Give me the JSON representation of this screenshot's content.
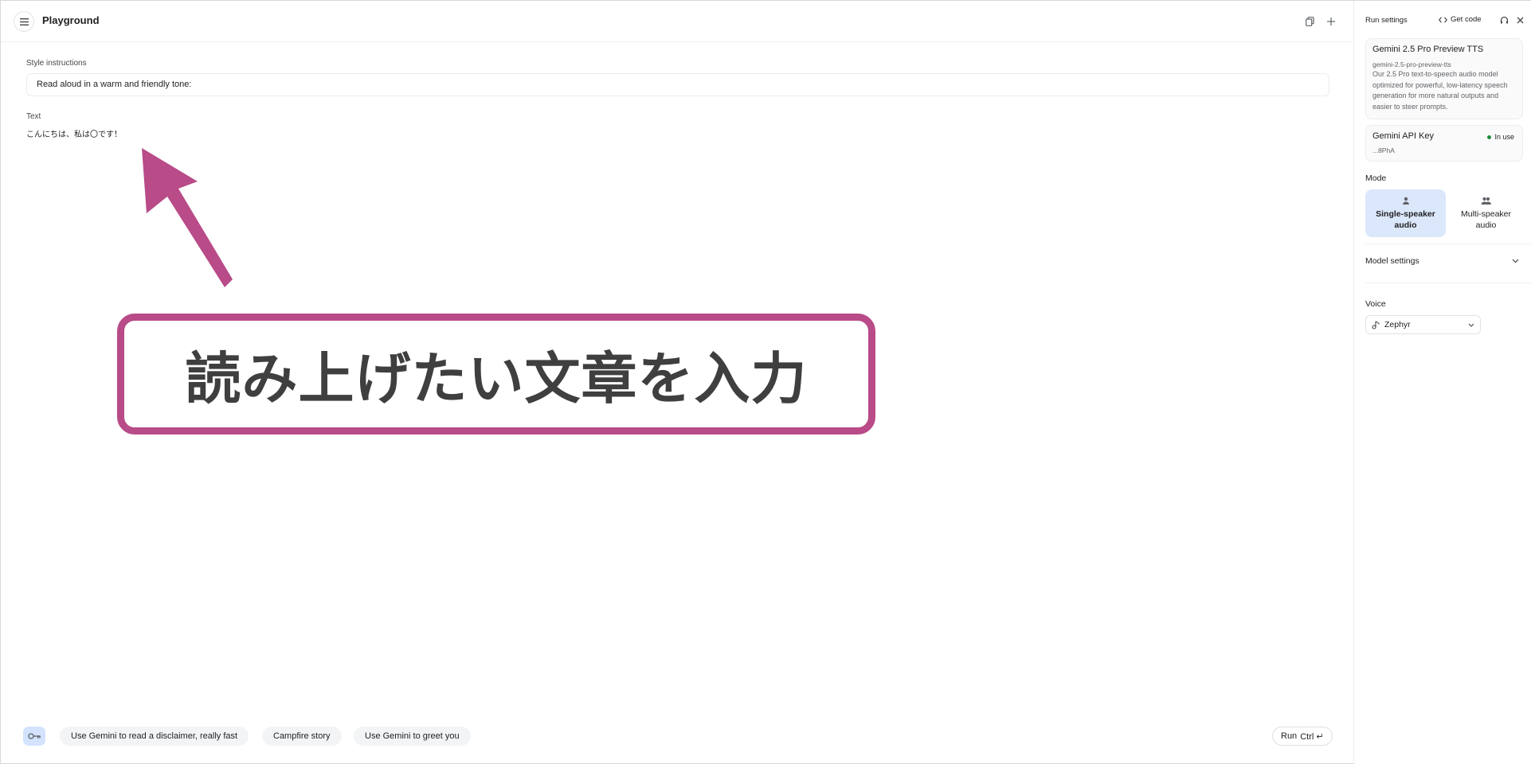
{
  "header": {
    "title": "Playground"
  },
  "style": {
    "label": "Style instructions",
    "value": "Read aloud in a warm and friendly tone:"
  },
  "text_field": {
    "label": "Text",
    "value": "こんにちは、私は〇です！"
  },
  "annotation": {
    "callout": "読み上げたい文章を入力",
    "color": "#b84b88"
  },
  "suggestions": [
    "Use Gemini to read a disclaimer, really fast",
    "Campfire story",
    "Use Gemini to greet you"
  ],
  "run": {
    "label": "Run",
    "shortcut": "Ctrl ↵"
  },
  "panel": {
    "title": "Run settings",
    "get_code": "Get code",
    "model": {
      "name": "Gemini 2.5 Pro Preview TTS",
      "id": "gemini-2.5-pro-preview-tts",
      "description": "Our 2.5 Pro text-to-speech audio model optimized for powerful, low-latency speech generation for more natural outputs and easier to steer prompts."
    },
    "api_key": {
      "title": "Gemini API Key",
      "status": "In use",
      "masked": "...8PhA"
    },
    "mode": {
      "label": "Mode",
      "single": "Single-speaker audio",
      "multi": "Multi-speaker audio"
    },
    "model_settings": "Model settings",
    "voice": {
      "label": "Voice",
      "value": "Zephyr"
    }
  },
  "colors": {
    "accent_active": "#dbe7fb",
    "status_green": "#1e8e3e"
  }
}
